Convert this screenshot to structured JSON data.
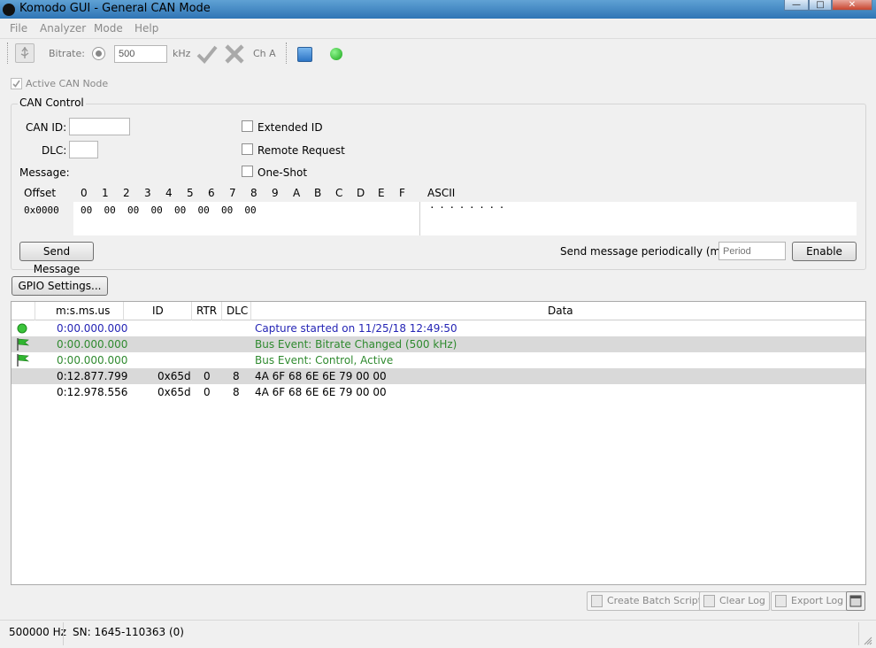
{
  "window": {
    "title": "Komodo GUI - General CAN Mode"
  },
  "menu": [
    "File",
    "Analyzer",
    "Mode",
    "Help"
  ],
  "toolbar": {
    "bitrate_label": "Bitrate:",
    "bitrate_value": "500",
    "bitrate_unit": "kHz",
    "channel": "Ch A"
  },
  "active_node_label": "Active CAN Node",
  "can_control": {
    "title": "CAN Control",
    "can_id_label": "CAN ID:",
    "dlc_label": "DLC:",
    "message_label": "Message:",
    "extended_id": "Extended ID",
    "remote_request": "Remote Request",
    "one_shot": "One-Shot",
    "offset_label": "Offset",
    "hex_cols": [
      "0",
      "1",
      "2",
      "3",
      "4",
      "5",
      "6",
      "7",
      "8",
      "9",
      "A",
      "B",
      "C",
      "D",
      "E",
      "F"
    ],
    "ascii_label": "ASCII",
    "offset_value": "0x0000",
    "hex_data": "00  00  00  00  00  00  00  00",
    "ascii_data": "· · · · · · · ·",
    "send_message": "Send Message",
    "periodic_label": "Send message periodically (ms):",
    "period_placeholder": "Period",
    "enable": "Enable"
  },
  "gpio_button": "GPIO Settings...",
  "log": {
    "headers": [
      "m:s.ms.us",
      "ID",
      "RTR",
      "DLC",
      "Data"
    ],
    "rows": [
      {
        "icon": "green-dot-icon",
        "time": "0:00.000.000",
        "id": "",
        "rtr": "",
        "dlc": "",
        "data": "Capture started on 11/25/18 12:49:50",
        "color": "#2525b5"
      },
      {
        "icon": "green-flag-icon",
        "time": "0:00.000.000",
        "id": "",
        "rtr": "",
        "dlc": "",
        "data": "Bus Event: Bitrate Changed (500 kHz)",
        "color": "#2f8a2f"
      },
      {
        "icon": "green-flag-icon",
        "time": "0:00.000.000",
        "id": "",
        "rtr": "",
        "dlc": "",
        "data": "Bus Event: Control, Active",
        "color": "#2f8a2f"
      },
      {
        "icon": "",
        "time": "0:12.877.799",
        "id": "0x65d",
        "rtr": "0",
        "dlc": "8",
        "data": "4A 6F 68 6E 6E 79 00 00",
        "color": "#000000"
      },
      {
        "icon": "",
        "time": "0:12.978.556",
        "id": "0x65d",
        "rtr": "0",
        "dlc": "8",
        "data": "4A 6F 68 6E 6E 79 00 00",
        "color": "#000000"
      }
    ]
  },
  "bottom_buttons": {
    "batch": "Create Batch Script",
    "clear": "Clear Log",
    "export": "Export Log"
  },
  "status": {
    "frequency": "500000 Hz",
    "serial": "SN: 1645-110363 (0)"
  }
}
